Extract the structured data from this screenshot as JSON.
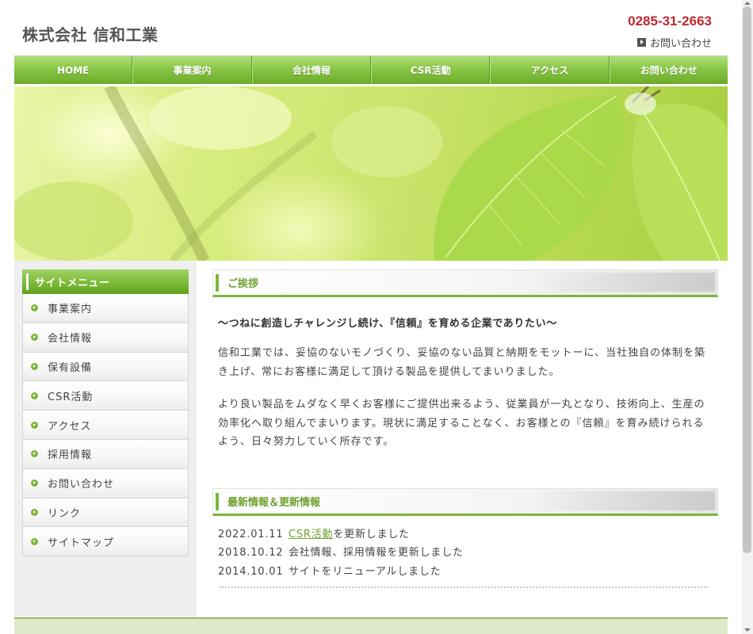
{
  "header": {
    "site_title": "株式会社 信和工業",
    "phone": "0285-31-2663",
    "contact_label": "お問い合わせ",
    "contact_icon": "arrow-box-icon"
  },
  "nav": [
    {
      "label": "HOME"
    },
    {
      "label": "事業案内"
    },
    {
      "label": "会社情報"
    },
    {
      "label": "CSR活動"
    },
    {
      "label": "アクセス"
    },
    {
      "label": "お問い合わせ"
    }
  ],
  "sidebar": {
    "title": "サイトメニュー",
    "bullet_icon": "circle-arrow-icon",
    "items": [
      {
        "label": "事業案内"
      },
      {
        "label": "会社情報"
      },
      {
        "label": "保有設備"
      },
      {
        "label": "CSR活動"
      },
      {
        "label": "アクセス"
      },
      {
        "label": "採用情報"
      },
      {
        "label": "お問い合わせ"
      },
      {
        "label": "リンク"
      },
      {
        "label": "サイトマップ"
      }
    ]
  },
  "greeting": {
    "heading": "ご挨拶",
    "lead": "〜つねに創造しチャレンジし続け、『信頼』を育める企業でありたい〜",
    "paragraphs": [
      "信和工業では、妥協のないモノづくり、妥協のない品質と納期をモットーに、当社独自の体制を築き上げ、常にお客様に満足して頂ける製品を提供してまいりました。",
      "より良い製品をムダなく早くお客様にご提供出来るよう、従業員が一丸となり、技術向上、生産の効率化へ取り組んでまいります。現状に満足することなく、お客様との『信頼』を育み続けられるよう、日々努力していく所存です。"
    ]
  },
  "news": {
    "heading": "最新情報＆更新情報",
    "items": [
      {
        "date": "2022.01.11",
        "link_text": "CSR活動",
        "text": "を更新しました"
      },
      {
        "date": "2018.10.12",
        "link_text": "",
        "text": "会社情報、採用情報を更新しました"
      },
      {
        "date": "2014.10.01",
        "link_text": "",
        "text": "サイトをリニューアルしました"
      }
    ]
  },
  "colors": {
    "accent_green": "#7cb53a",
    "phone_red": "#c0282e",
    "heading_green": "#6ea12f"
  }
}
